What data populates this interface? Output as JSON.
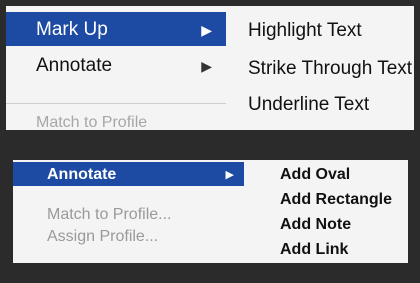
{
  "menu1": {
    "items": [
      {
        "label": "Mark Up",
        "arrow": "▶"
      },
      {
        "label": "Annotate",
        "arrow": "▶"
      },
      {
        "label": "Match to Profile"
      }
    ],
    "submenu": [
      "Highlight Text",
      "Strike Through Text",
      "Underline Text"
    ]
  },
  "menu2": {
    "items": [
      {
        "label": "Annotate",
        "arrow": "▶"
      },
      {
        "label": "Match to Profile..."
      },
      {
        "label": "Assign Profile..."
      }
    ],
    "submenu": [
      "Add Oval",
      "Add Rectangle",
      "Add Note",
      "Add Link"
    ]
  },
  "colors": {
    "highlight": "#1d4aa3",
    "menu_bg": "#f4f4f4",
    "disabled": "#a7a7a7",
    "background": "#2b2b2b"
  }
}
